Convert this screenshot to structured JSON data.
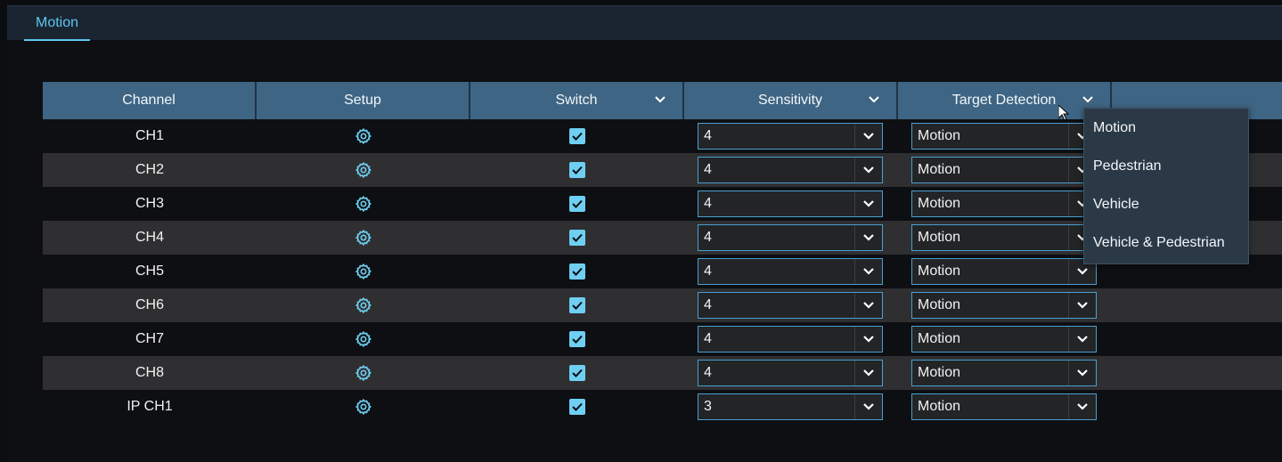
{
  "tabs": [
    {
      "label": "Motion",
      "active": true
    }
  ],
  "table": {
    "headers": {
      "channel": "Channel",
      "setup": "Setup",
      "switch": "Switch",
      "sensitivity": "Sensitivity",
      "target": "Target Detection"
    },
    "rows": [
      {
        "channel": "CH1",
        "switch": true,
        "sensitivity": "4",
        "target": "Motion"
      },
      {
        "channel": "CH2",
        "switch": true,
        "sensitivity": "4",
        "target": "Motion"
      },
      {
        "channel": "CH3",
        "switch": true,
        "sensitivity": "4",
        "target": "Motion"
      },
      {
        "channel": "CH4",
        "switch": true,
        "sensitivity": "4",
        "target": "Motion"
      },
      {
        "channel": "CH5",
        "switch": true,
        "sensitivity": "4",
        "target": "Motion"
      },
      {
        "channel": "CH6",
        "switch": true,
        "sensitivity": "4",
        "target": "Motion"
      },
      {
        "channel": "CH7",
        "switch": true,
        "sensitivity": "4",
        "target": "Motion"
      },
      {
        "channel": "CH8",
        "switch": true,
        "sensitivity": "4",
        "target": "Motion"
      },
      {
        "channel": "IP CH1",
        "switch": true,
        "sensitivity": "3",
        "target": "Motion"
      }
    ]
  },
  "dropdown": {
    "options": [
      "Motion",
      "Pedestrian",
      "Vehicle",
      "Vehicle & Pedestrian"
    ]
  },
  "colors": {
    "accent": "#5cc6f0",
    "header": "#3e6583",
    "checkbox": "#6ecff2"
  }
}
